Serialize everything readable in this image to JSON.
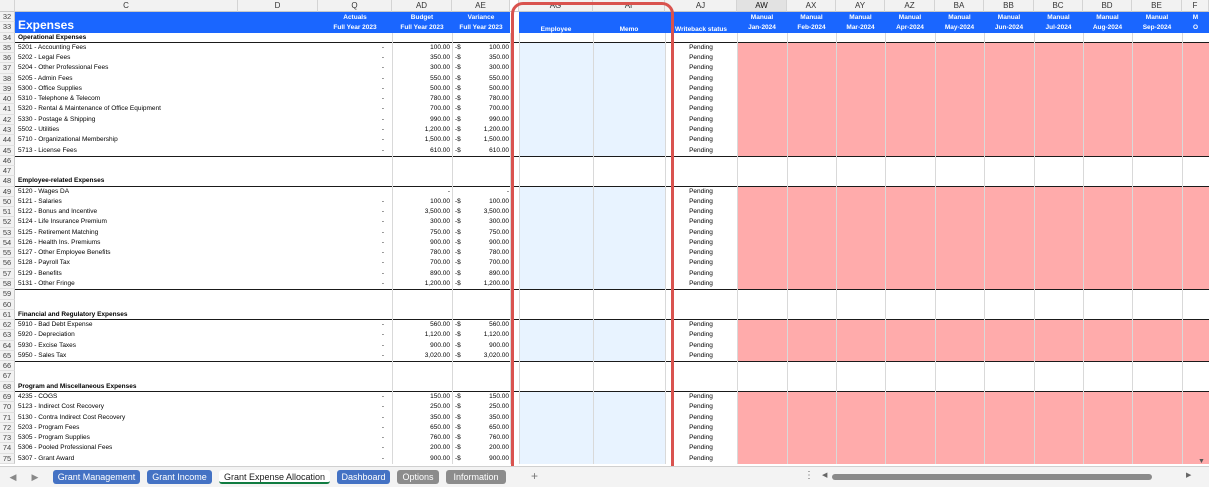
{
  "columns": [
    {
      "letter": "C"
    },
    {
      "letter": "D"
    },
    {
      "letter": "Q"
    },
    {
      "letter": "AD"
    },
    {
      "letter": "AE"
    },
    {
      "letter": "AG"
    },
    {
      "letter": "AI"
    },
    {
      "letter": "AJ"
    },
    {
      "letter": "AW"
    },
    {
      "letter": "AX"
    },
    {
      "letter": "AY"
    },
    {
      "letter": "AZ"
    },
    {
      "letter": "BA"
    },
    {
      "letter": "BB"
    },
    {
      "letter": "BC"
    },
    {
      "letter": "BD"
    },
    {
      "letter": "BE"
    },
    {
      "letter": "F"
    }
  ],
  "header": {
    "title": "Expenses",
    "actuals_1": "Actuals",
    "actuals_2": "Full Year 2023",
    "budget_1": "Budget",
    "budget_2": "Full Year 2023",
    "variance_1": "Variance",
    "variance_2": "Full Year 2023",
    "employee": "Employee",
    "memo": "Memo",
    "writeback": "Writeback status",
    "months": [
      {
        "top": "Manual",
        "bottom": "Jan-2024"
      },
      {
        "top": "Manual",
        "bottom": "Feb-2024"
      },
      {
        "top": "Manual",
        "bottom": "Mar-2024"
      },
      {
        "top": "Manual",
        "bottom": "Apr-2024"
      },
      {
        "top": "Manual",
        "bottom": "May-2024"
      },
      {
        "top": "Manual",
        "bottom": "Jun-2024"
      },
      {
        "top": "Manual",
        "bottom": "Jul-2024"
      },
      {
        "top": "Manual",
        "bottom": "Aug-2024"
      },
      {
        "top": "Manual",
        "bottom": "Sep-2024"
      },
      {
        "top": "M",
        "bottom": "O"
      }
    ]
  },
  "rows": [
    {
      "n": "32",
      "kind": "hdr"
    },
    {
      "n": "33",
      "kind": "hdr"
    },
    {
      "n": "34",
      "kind": "section",
      "label": "Operational Expenses"
    },
    {
      "n": "35",
      "kind": "item",
      "label": "5201 - Accounting Fees",
      "actual": "-",
      "budget": "100.00",
      "vsign": "-$",
      "variance": "100.00",
      "status": "Pending"
    },
    {
      "n": "36",
      "kind": "item",
      "label": "5202 - Legal Fees",
      "actual": "-",
      "budget": "350.00",
      "vsign": "-$",
      "variance": "350.00",
      "status": "Pending"
    },
    {
      "n": "37",
      "kind": "item",
      "label": "5204 - Other Professional Fees",
      "actual": "-",
      "budget": "300.00",
      "vsign": "-$",
      "variance": "300.00",
      "status": "Pending"
    },
    {
      "n": "38",
      "kind": "item",
      "label": "5205 - Admin Fees",
      "actual": "-",
      "budget": "550.00",
      "vsign": "-$",
      "variance": "550.00",
      "status": "Pending"
    },
    {
      "n": "39",
      "kind": "item",
      "label": "5300 - Office Supplies",
      "actual": "-",
      "budget": "500.00",
      "vsign": "-$",
      "variance": "500.00",
      "status": "Pending"
    },
    {
      "n": "40",
      "kind": "item",
      "label": "5310 - Telephone & Telecom",
      "actual": "-",
      "budget": "780.00",
      "vsign": "-$",
      "variance": "780.00",
      "status": "Pending"
    },
    {
      "n": "41",
      "kind": "item",
      "label": "5320 - Rental & Maintenance of Office Equipment",
      "actual": "-",
      "budget": "700.00",
      "vsign": "-$",
      "variance": "700.00",
      "status": "Pending"
    },
    {
      "n": "42",
      "kind": "item",
      "label": "5330 - Postage & Shipping",
      "actual": "-",
      "budget": "990.00",
      "vsign": "-$",
      "variance": "990.00",
      "status": "Pending"
    },
    {
      "n": "43",
      "kind": "item",
      "label": "5502 - Utilities",
      "actual": "-",
      "budget": "1,200.00",
      "vsign": "-$",
      "variance": "1,200.00",
      "status": "Pending"
    },
    {
      "n": "44",
      "kind": "item",
      "label": "5710 - Organizational Membership",
      "actual": "-",
      "budget": "1,500.00",
      "vsign": "-$",
      "variance": "1,500.00",
      "status": "Pending"
    },
    {
      "n": "45",
      "kind": "item",
      "label": "5713 - License Fees",
      "actual": "-",
      "budget": "610.00",
      "vsign": "-$",
      "variance": "610.00",
      "status": "Pending"
    },
    {
      "n": "46",
      "kind": "blank"
    },
    {
      "n": "47",
      "kind": "blank"
    },
    {
      "n": "48",
      "kind": "section",
      "label": "Employee-related Expenses"
    },
    {
      "n": "49",
      "kind": "item",
      "label": "5120 - Wages DA",
      "actual": "",
      "budget": "-",
      "vsign": "",
      "variance": "-",
      "status": "Pending"
    },
    {
      "n": "50",
      "kind": "item",
      "label": "5121 - Salaries",
      "actual": "-",
      "budget": "100.00",
      "vsign": "-$",
      "variance": "100.00",
      "status": "Pending"
    },
    {
      "n": "51",
      "kind": "item",
      "label": "5122 - Bonus and Incentive",
      "actual": "-",
      "budget": "3,500.00",
      "vsign": "-$",
      "variance": "3,500.00",
      "status": "Pending"
    },
    {
      "n": "52",
      "kind": "item",
      "label": "5124 - Life Insurance Premium",
      "actual": "-",
      "budget": "300.00",
      "vsign": "-$",
      "variance": "300.00",
      "status": "Pending"
    },
    {
      "n": "53",
      "kind": "item",
      "label": "5125 - Retirement Matching",
      "actual": "-",
      "budget": "750.00",
      "vsign": "-$",
      "variance": "750.00",
      "status": "Pending"
    },
    {
      "n": "54",
      "kind": "item",
      "label": "5126 - Health Ins. Premiums",
      "actual": "-",
      "budget": "900.00",
      "vsign": "-$",
      "variance": "900.00",
      "status": "Pending"
    },
    {
      "n": "55",
      "kind": "item",
      "label": "5127 - Other Employee Benefits",
      "actual": "-",
      "budget": "780.00",
      "vsign": "-$",
      "variance": "780.00",
      "status": "Pending"
    },
    {
      "n": "56",
      "kind": "item",
      "label": "5128 - Payroll Tax",
      "actual": "-",
      "budget": "700.00",
      "vsign": "-$",
      "variance": "700.00",
      "status": "Pending"
    },
    {
      "n": "57",
      "kind": "item",
      "label": "5129 - Benefits",
      "actual": "-",
      "budget": "890.00",
      "vsign": "-$",
      "variance": "890.00",
      "status": "Pending"
    },
    {
      "n": "58",
      "kind": "item",
      "label": "5131 - Other Fringe",
      "actual": "-",
      "budget": "1,200.00",
      "vsign": "-$",
      "variance": "1,200.00",
      "status": "Pending"
    },
    {
      "n": "59",
      "kind": "blank"
    },
    {
      "n": "60",
      "kind": "blank"
    },
    {
      "n": "61",
      "kind": "section",
      "label": "Financial and Regulatory Expenses"
    },
    {
      "n": "62",
      "kind": "item",
      "label": "5910 - Bad Debt Expense",
      "actual": "-",
      "budget": "560.00",
      "vsign": "-$",
      "variance": "560.00",
      "status": "Pending"
    },
    {
      "n": "63",
      "kind": "item",
      "label": "5920 - Depreciation",
      "actual": "-",
      "budget": "1,120.00",
      "vsign": "-$",
      "variance": "1,120.00",
      "status": "Pending"
    },
    {
      "n": "64",
      "kind": "item",
      "label": "5930 - Excise Taxes",
      "actual": "-",
      "budget": "900.00",
      "vsign": "-$",
      "variance": "900.00",
      "status": "Pending"
    },
    {
      "n": "65",
      "kind": "item",
      "label": "5950 - Sales Tax",
      "actual": "-",
      "budget": "3,020.00",
      "vsign": "-$",
      "variance": "3,020.00",
      "status": "Pending"
    },
    {
      "n": "66",
      "kind": "blank"
    },
    {
      "n": "67",
      "kind": "blank"
    },
    {
      "n": "68",
      "kind": "section",
      "label": "Program and Miscellaneous Expenses"
    },
    {
      "n": "69",
      "kind": "item",
      "label": "4235 - COGS",
      "actual": "-",
      "budget": "150.00",
      "vsign": "-$",
      "variance": "150.00",
      "status": "Pending"
    },
    {
      "n": "70",
      "kind": "item",
      "label": "5123 - Indirect Cost Recovery",
      "actual": "-",
      "budget": "250.00",
      "vsign": "-$",
      "variance": "250.00",
      "status": "Pending"
    },
    {
      "n": "71",
      "kind": "item",
      "label": "5130 - Contra Indirect Cost Recovery",
      "actual": "-",
      "budget": "350.00",
      "vsign": "-$",
      "variance": "350.00",
      "status": "Pending"
    },
    {
      "n": "72",
      "kind": "item",
      "label": "5203 - Program Fees",
      "actual": "-",
      "budget": "650.00",
      "vsign": "-$",
      "variance": "650.00",
      "status": "Pending"
    },
    {
      "n": "73",
      "kind": "item",
      "label": "5305 - Program Supplies",
      "actual": "-",
      "budget": "760.00",
      "vsign": "-$",
      "variance": "760.00",
      "status": "Pending"
    },
    {
      "n": "74",
      "kind": "item",
      "label": "5306 - Pooled Professional Fees",
      "actual": "-",
      "budget": "200.00",
      "vsign": "-$",
      "variance": "200.00",
      "status": "Pending"
    },
    {
      "n": "75",
      "kind": "item",
      "label": "5307 - Grant Award",
      "actual": "-",
      "budget": "900.00",
      "vsign": "-$",
      "variance": "900.00",
      "status": "Pending"
    }
  ],
  "tabs": [
    {
      "label": "Grant Management",
      "style": "blue"
    },
    {
      "label": "Grant Income",
      "style": "blue"
    },
    {
      "label": "Grant Expense Allocation",
      "style": "active"
    },
    {
      "label": "Dashboard",
      "style": "blue"
    },
    {
      "label": "Options",
      "style": "gray"
    },
    {
      "label": "Information",
      "style": "gray"
    }
  ],
  "add_sheet_glyph": "+",
  "colors": {
    "header_blue": "#1a66ff",
    "pink": "#ffabab",
    "light_blue": "#e8f3ff",
    "highlight_red": "#d9534f"
  }
}
